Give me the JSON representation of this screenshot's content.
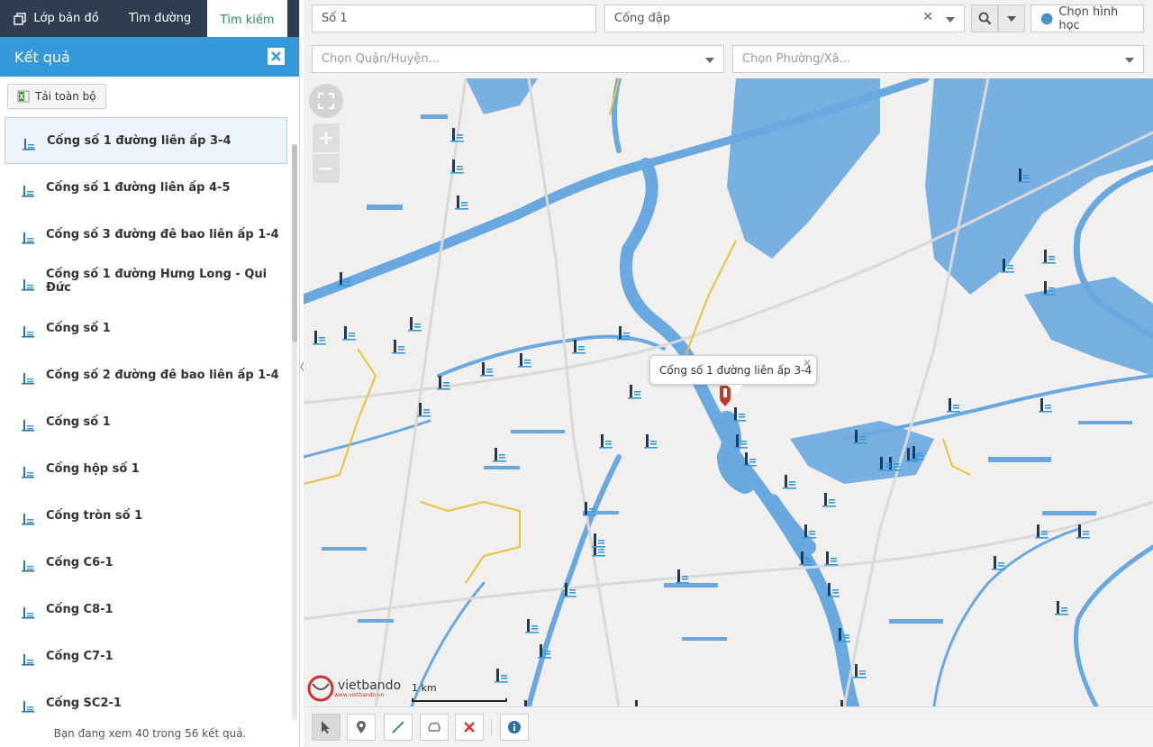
{
  "tabs": [
    {
      "label": "Lớp bản đồ",
      "icon": "layers-icon"
    },
    {
      "label": "Tìm đường",
      "icon": null
    },
    {
      "label": "Tìm kiếm",
      "icon": null,
      "active": true
    }
  ],
  "results": {
    "title": "Kết quả",
    "download_label": "Tải toàn bộ",
    "items": [
      "Cống số 1 đường liên ấp 3-4",
      "Cống số 1 đường liên ấp 4-5",
      "Cống số 3 đường đê bao liên ấp 1-4",
      "Cống số 1 đường Hưng Long - Qui Đức",
      "Cống số 1",
      "Cống số 2 đường đê bao liên ấp 1-4",
      "Cống số 1",
      "Cống hộp số 1",
      "Cống tròn số 1",
      "Cống C6-1",
      "Cống C8-1",
      "Cống C7-1",
      "Cống SC2-1"
    ],
    "selected_index": 0,
    "footer": "Bạn đang xem 40 trong 56 kết quả."
  },
  "search": {
    "keyword_value": "Số 1",
    "category_value": "Cống đập",
    "district_placeholder": "Chọn Quận/Huyện...",
    "ward_placeholder": "Chọn Phường/Xã...",
    "geometry_button": "Chọn hình học"
  },
  "map": {
    "popup_text": "Cống số 1 đường liên ấp 3-4",
    "logo_text": "vietbando",
    "logo_sub": "www.vietbando.vn",
    "scale_label": "1 km",
    "water_color": "#6aa9e0",
    "road_color": "#d6d6d6",
    "boundary_color": "#e8c23a"
  },
  "toolbar": {
    "tools": [
      "pointer-icon",
      "marker-icon",
      "line-icon",
      "polygon-icon",
      "delete-icon",
      "info-icon"
    ]
  }
}
